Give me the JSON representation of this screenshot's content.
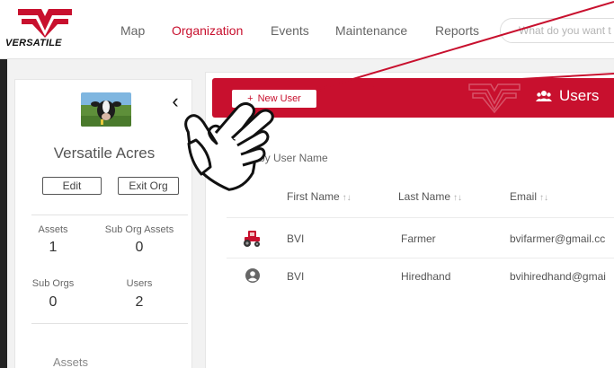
{
  "brand": {
    "name": "VERSATILE",
    "accent": "#c8102e"
  },
  "nav": {
    "items": [
      {
        "label": "Map",
        "active": false
      },
      {
        "label": "Organization",
        "active": true
      },
      {
        "label": "Events",
        "active": false
      },
      {
        "label": "Maintenance",
        "active": false
      },
      {
        "label": "Reports",
        "active": false
      }
    ],
    "search_placeholder": "What do you want t"
  },
  "sidebar": {
    "org_name": "Versatile Acres",
    "collapse_icon": "chevron-left-icon",
    "buttons": {
      "edit": "Edit",
      "exit": "Exit Org"
    },
    "stats": [
      {
        "label": "Assets",
        "value": "1"
      },
      {
        "label": "Sub Org Assets",
        "value": "0"
      },
      {
        "label": "Sub Orgs",
        "value": "0"
      },
      {
        "label": "Users",
        "value": "2"
      }
    ],
    "section_title": "Assets"
  },
  "users_panel": {
    "new_user_label": "New User",
    "new_user_icon": "plus-icon",
    "title": "Users",
    "title_icon": "users-icon",
    "filter_placeholder": "Filter by User Name",
    "columns": [
      "First Name",
      "Last Name",
      "Email"
    ],
    "sort_icon": "↑↓",
    "rows": [
      {
        "avatar": "tractor-icon",
        "first": "BVI",
        "last": "Farmer",
        "email": "bvifarmer@gmail.cc"
      },
      {
        "avatar": "user-circle-icon",
        "first": "BVI",
        "last": "Hiredhand",
        "email": "bvihiredhand@gmai"
      }
    ]
  },
  "annotation": {
    "pointer_icon": "pointing-hand-icon",
    "arrow_color": "#c8102e"
  }
}
